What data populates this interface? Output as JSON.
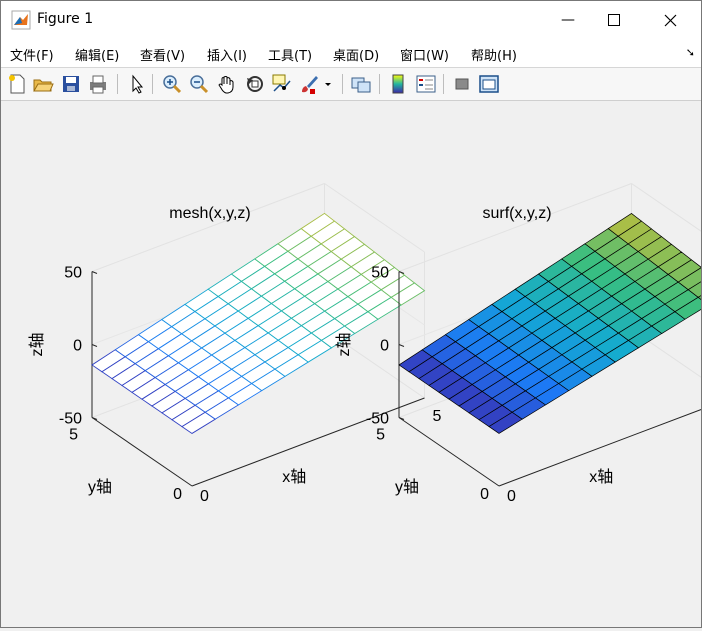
{
  "window": {
    "title": "Figure 1",
    "controls": {
      "minimize": "—",
      "maximize": "☐",
      "close": "✕"
    }
  },
  "menu": [
    "文件(F)",
    "编辑(E)",
    "查看(V)",
    "插入(I)",
    "工具(T)",
    "桌面(D)",
    "窗口(W)",
    "帮助(H)"
  ],
  "toolbar": [
    "new-figure-icon",
    "open-icon",
    "save-icon",
    "print-icon",
    "edit-plot-icon",
    "zoom-in-icon",
    "zoom-out-icon",
    "pan-icon",
    "rotate-3d-icon",
    "data-cursor-icon",
    "brush-icon",
    "link-plot-icon",
    "colorbar-icon",
    "legend-icon",
    "hide-tools-icon",
    "dock-icon"
  ],
  "chart_data": [
    {
      "type": "mesh",
      "title": "mesh(x,y,z)",
      "xlabel": "x轴",
      "ylabel": "y轴",
      "zlabel": "z轴",
      "xlim": [
        0,
        5
      ],
      "ylim": [
        0,
        5
      ],
      "zlim": [
        -50,
        50
      ],
      "xticks": [
        "0",
        "5"
      ],
      "yticks": [
        "0",
        "5"
      ],
      "zticks": [
        "50",
        "0",
        "-50"
      ],
      "colormap": "parula",
      "grid": true
    },
    {
      "type": "surf",
      "title": "surf(x,y,z)",
      "xlabel": "x轴",
      "ylabel": "y轴",
      "zlabel": "z轴",
      "xlim": [
        0,
        5
      ],
      "ylim": [
        0,
        5
      ],
      "zlim": [
        -50,
        50
      ],
      "xticks": [
        "0",
        "5"
      ],
      "yticks": [
        "0",
        "5"
      ],
      "zticks": [
        "50",
        "0",
        "-50"
      ],
      "colormap": "parula",
      "grid": true
    }
  ]
}
